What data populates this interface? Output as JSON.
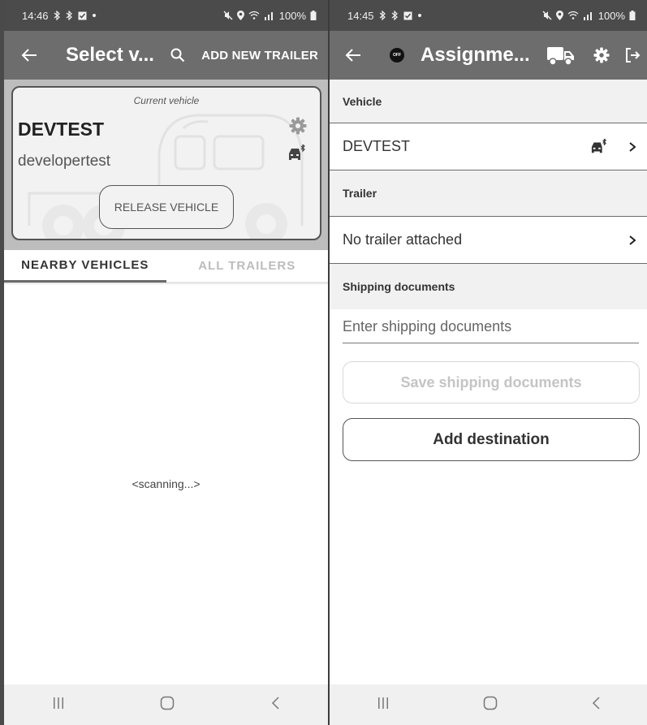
{
  "left": {
    "status": {
      "time": "14:46",
      "battery": "100%"
    },
    "appbar": {
      "title": "Select v...",
      "add_trailer_label": "ADD NEW TRAILER"
    },
    "card": {
      "subtitle": "Current vehicle",
      "vehicle_name": "DEVTEST",
      "username": "developertest",
      "release_label": "RELEASE VEHICLE"
    },
    "tabs": [
      {
        "label": "NEARBY VEHICLES",
        "active": true
      },
      {
        "label": "ALL TRAILERS",
        "active": false
      }
    ],
    "scanning_text": "<scanning...>"
  },
  "right": {
    "status": {
      "time": "14:45",
      "battery": "100%"
    },
    "appbar": {
      "title": "Assignme...",
      "off_badge": "OFF"
    },
    "vehicle_section": {
      "header": "Vehicle",
      "value": "DEVTEST"
    },
    "trailer_section": {
      "header": "Trailer",
      "value": "No trailer attached"
    },
    "shipping_section": {
      "header": "Shipping documents",
      "placeholder": "Enter shipping documents",
      "save_label": "Save shipping documents"
    },
    "add_destination_label": "Add destination"
  },
  "icons": {
    "back": "arrow-left-icon",
    "search": "search-icon",
    "gear": "gear-icon",
    "bluetooth_car": "car-bluetooth-icon",
    "truck": "truck-icon",
    "logout": "logout-icon",
    "chevron": "chevron-right-icon",
    "nav_recents": "recents-icon",
    "nav_home": "home-icon",
    "nav_back": "nav-back-icon"
  },
  "colors": {
    "status_bar": "#4b4b4b",
    "app_bar": "#6d6d6d",
    "section_header": "#f1f1f1",
    "card_border": "#555555"
  }
}
